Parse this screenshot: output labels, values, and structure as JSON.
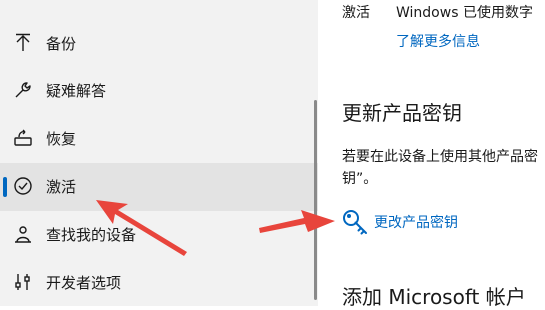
{
  "sidebar": {
    "items": [
      {
        "label": "备份",
        "icon": "arrow-up-icon"
      },
      {
        "label": "疑难解答",
        "icon": "wrench-icon"
      },
      {
        "label": "恢复",
        "icon": "recovery-icon"
      },
      {
        "label": "激活",
        "icon": "check-circle-icon",
        "active": true
      },
      {
        "label": "查找我的设备",
        "icon": "person-location-icon"
      },
      {
        "label": "开发者选项",
        "icon": "developer-sliders-icon"
      }
    ]
  },
  "activation": {
    "label": "激活",
    "value": "Windows 已使用数字",
    "learn_more": "了解更多信息"
  },
  "update_key": {
    "title": "更新产品密钥",
    "description": "若要在此设备上使用其他产品密钥”。",
    "change_link": "更改产品密钥",
    "icon": "key-icon"
  },
  "add_account": {
    "title": "添加 Microsoft 帐户"
  },
  "colors": {
    "accent": "#0067c0",
    "annotation_arrow": "#e8453c",
    "sidebar_bg": "#f2f2f2",
    "active_bg": "#e3e3e3"
  }
}
